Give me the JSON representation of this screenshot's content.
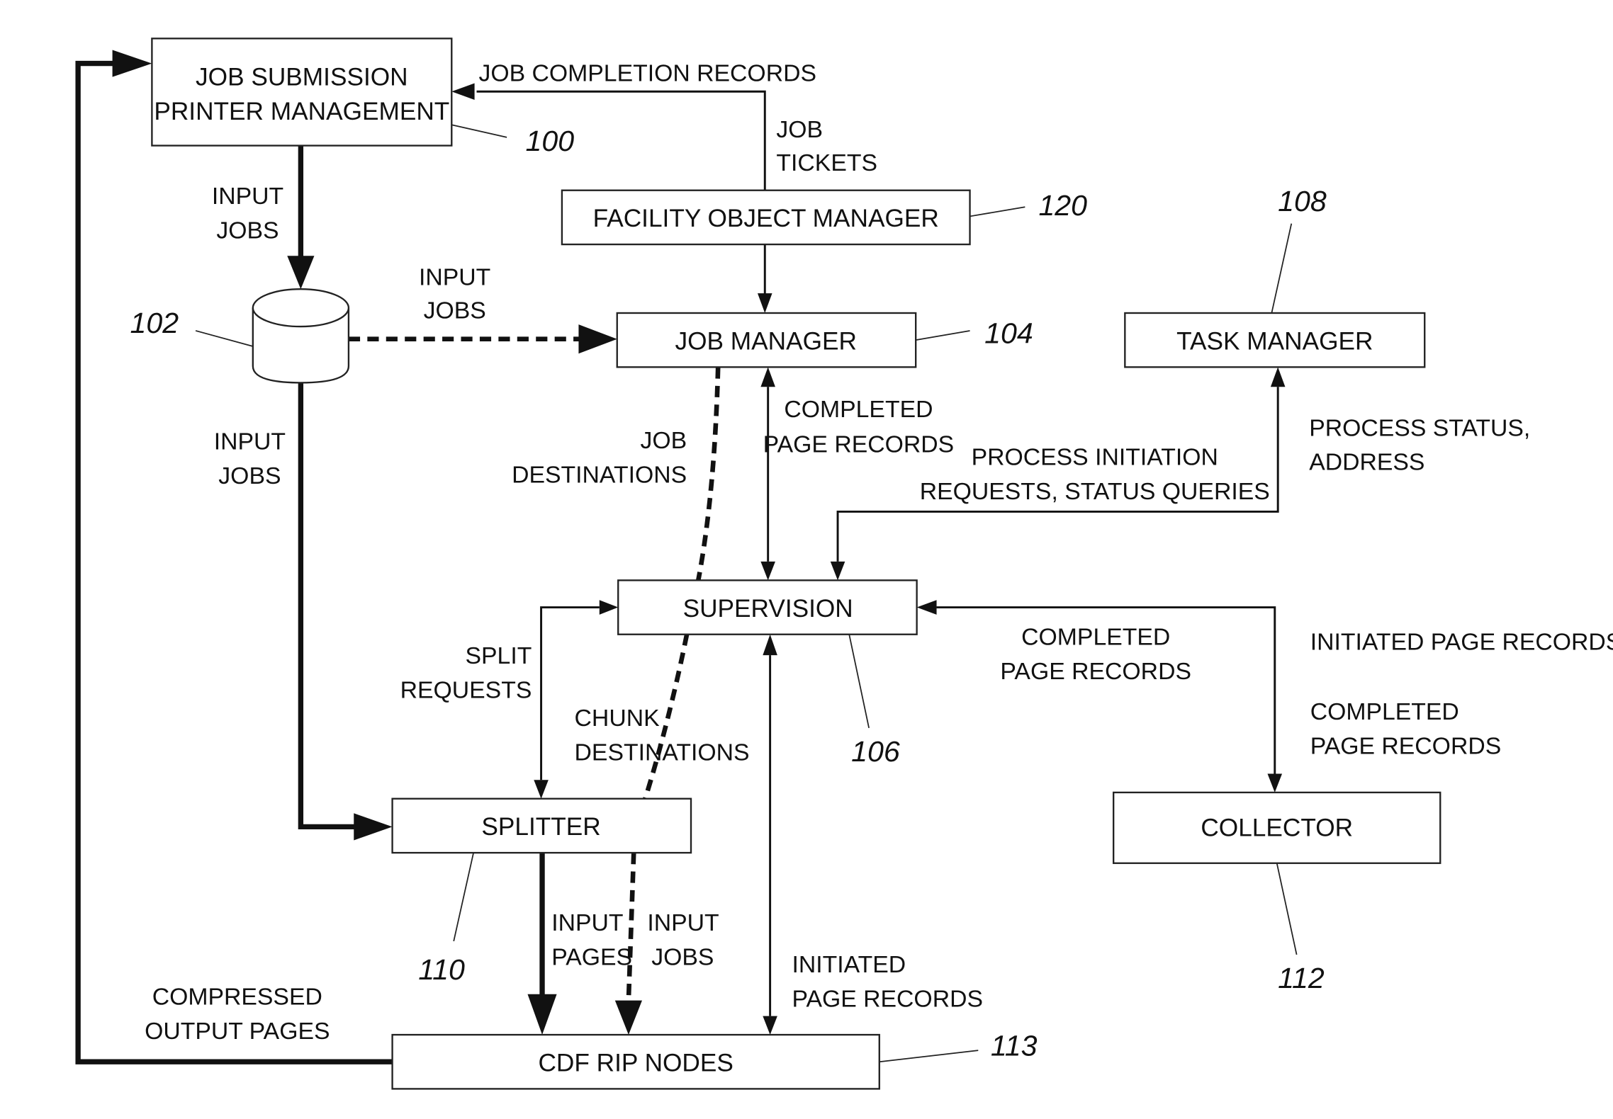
{
  "diagram": {
    "blocks": {
      "job_submission": {
        "line1": "JOB SUBMISSION",
        "line2": "PRINTER MANAGEMENT",
        "ref": "100"
      },
      "storage": {
        "ref": "102"
      },
      "facility_object_manager": {
        "label": "FACILITY OBJECT MANAGER",
        "ref": "120"
      },
      "job_manager": {
        "label": "JOB MANAGER",
        "ref": "104"
      },
      "task_manager": {
        "label": "TASK MANAGER",
        "ref": "108"
      },
      "supervision": {
        "label": "SUPERVISION",
        "ref": "106"
      },
      "splitter": {
        "label": "SPLITTER",
        "ref": "110"
      },
      "collector": {
        "label": "COLLECTOR",
        "ref": "112"
      },
      "cdf_rip_nodes": {
        "label": "CDF RIP NODES",
        "ref": "113"
      }
    },
    "flows": {
      "job_completion_records": "JOB COMPLETION RECORDS",
      "job_tickets": [
        "JOB",
        "TICKETS"
      ],
      "input_jobs_top": [
        "INPUT",
        "JOBS"
      ],
      "input_jobs_dashed": [
        "INPUT",
        "JOBS"
      ],
      "input_jobs_left": [
        "INPUT",
        "JOBS"
      ],
      "job_destinations": [
        "JOB",
        "DESTINATIONS"
      ],
      "completed_page_records_jm": [
        "COMPLETED",
        "PAGE RECORDS"
      ],
      "process_initiation": [
        "PROCESS INITIATION",
        "REQUESTS, STATUS QUERIES"
      ],
      "process_status": [
        "PROCESS STATUS,",
        "ADDRESS"
      ],
      "split_requests": [
        "SPLIT",
        "REQUESTS"
      ],
      "chunk_destinations": [
        "CHUNK",
        "DESTINATIONS"
      ],
      "completed_page_records_sup": [
        "COMPLETED",
        "PAGE RECORDS"
      ],
      "initiated_page_records_right": "INITIATED PAGE RECORDS",
      "completed_page_records_right": [
        "COMPLETED",
        "PAGE RECORDS"
      ],
      "input_pages": [
        "INPUT",
        "PAGES"
      ],
      "input_jobs_splitter": [
        "INPUT",
        "JOBS"
      ],
      "initiated_page_records_rip": [
        "INITIATED",
        "PAGE RECORDS"
      ],
      "compressed_output_pages": [
        "COMPRESSED",
        "OUTPUT PAGES"
      ]
    }
  }
}
